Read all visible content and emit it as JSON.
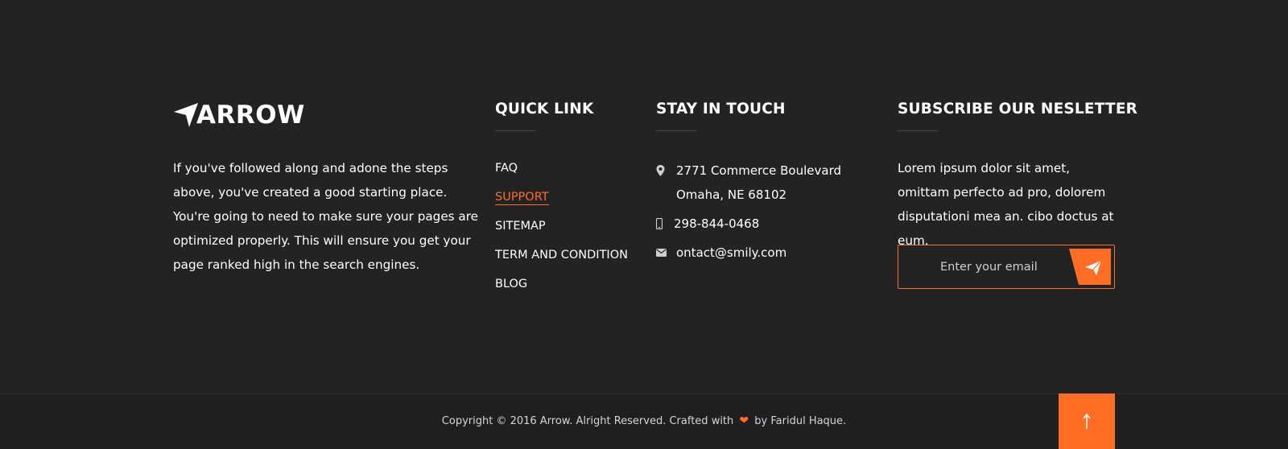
{
  "brand": {
    "logo_text": "ARROW",
    "about": "If you've followed along and adone the steps above, you've created a good starting place. You're going to need to make sure your pages are optimized properly. This will ensure you get your page ranked high in the search engines."
  },
  "quick_links": {
    "title": "QUICK LINK",
    "items": [
      {
        "label": "FAQ",
        "active": false
      },
      {
        "label": "SUPPORT",
        "active": true
      },
      {
        "label": "SITEMAP",
        "active": false
      },
      {
        "label": "TERM AND CONDITION",
        "active": false
      },
      {
        "label": "BLOG",
        "active": false
      }
    ]
  },
  "contact": {
    "title": "STAY IN TOUCH",
    "address_line1": "2771 Commerce Boulevard",
    "address_line2": "Omaha, NE 68102",
    "phone": "298-844-0468",
    "email": "ontact@smily.com",
    "icons": [
      "map-pin-icon",
      "mobile-phone-icon",
      "envelope-icon"
    ]
  },
  "newsletter": {
    "title": "SUBSCRIBE OUR NESLETTER",
    "text": "Lorem ipsum dolor sit amet, omittam perfecto ad pro, dolorem disputationi mea an. cibo doctus at eum.",
    "placeholder": "Enter your email",
    "value": "",
    "button_icon": "paper-plane-icon"
  },
  "footer": {
    "copyright_before": "Copyright © 2016 Arrow. Alright Reserved. Crafted with",
    "heart": "❤",
    "copyright_after": "by Faridul Haque.",
    "back_to_top_icon": "arrow-up-icon"
  },
  "colors": {
    "accent": "#ff6d24",
    "background": "#232323",
    "bottom_bar": "#1f1f1f",
    "text": "#ffffff"
  }
}
